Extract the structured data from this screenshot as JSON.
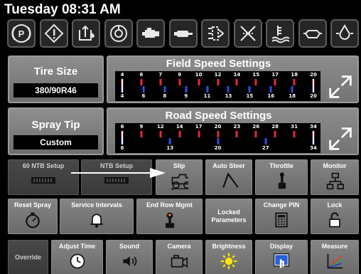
{
  "header": {
    "title": "Tuesday 08:31 AM"
  },
  "warning_icons": [
    {
      "icon": "parking-brake-icon"
    },
    {
      "icon": "warning-diamond-icon"
    },
    {
      "icon": "hydraulic-oil-icon"
    },
    {
      "icon": "engine-oil-pressure-icon"
    },
    {
      "icon": "engine-icon"
    },
    {
      "icon": "transmission-icon"
    },
    {
      "icon": "air-filter-icon"
    },
    {
      "icon": "fuel-filter-icon"
    },
    {
      "icon": "coolant-level-icon"
    },
    {
      "icon": "engine-check-icon"
    },
    {
      "icon": "oil-drop-icon"
    }
  ],
  "tire_size": {
    "label": "Tire Size",
    "value": "380/90R46"
  },
  "spray_tip": {
    "label": "Spray Tip",
    "value": "Custom"
  },
  "field_speed": {
    "title": "Field Speed Settings",
    "top_ticks": [
      "4",
      "6",
      "7",
      "9",
      "10",
      "12",
      "14",
      "15",
      "17",
      "18",
      "20"
    ],
    "bottom_ticks": [
      "4",
      "6",
      "8",
      "9",
      "11",
      "13",
      "15",
      "16",
      "18",
      "20"
    ]
  },
  "road_speed": {
    "title": "Road Speed Settings",
    "top_ticks": [
      "6",
      "9",
      "12",
      "14",
      "17",
      "20",
      "23",
      "26",
      "28",
      "31",
      "34"
    ],
    "bottom_ticks": [
      "6",
      "13",
      "20",
      "27",
      "34"
    ]
  },
  "grid": {
    "row1": [
      {
        "label": "60 NTB Setup",
        "icon": "ntb-wheel-icon",
        "dark": true
      },
      {
        "label": "NTB Setup",
        "icon": "ntb-wheel-icon",
        "dark": true
      },
      {
        "label": "Slip",
        "icon": "tractor-slip-icon",
        "dark": false
      },
      {
        "label": "Auto Steer",
        "icon": "steering-arrow-icon",
        "dark": false
      },
      {
        "label": "Throttle",
        "icon": "throttle-lever-icon",
        "dark": false
      },
      {
        "label": "Monitor",
        "icon": "network-icon",
        "dark": false
      }
    ],
    "row2": [
      {
        "label": "Reset Spray",
        "icon": "stopwatch-icon",
        "dark": false
      },
      {
        "label": "Service Intervals",
        "icon": "bell-icon",
        "dark": false
      },
      {
        "label": "End Row Mgmt",
        "icon": "joystick-icon",
        "dark": false
      },
      {
        "label": "Locked\nParameters",
        "icon": "",
        "dark": false
      },
      {
        "label": "Change PIN",
        "icon": "keypad-icon",
        "dark": false
      },
      {
        "label": "Lock",
        "icon": "padlock-icon",
        "dark": false
      }
    ],
    "row3": [
      {
        "label": "Override",
        "icon": "",
        "dark": true
      },
      {
        "label": "Adjust Time",
        "icon": "clock-icon",
        "dark": false
      },
      {
        "label": "Sound",
        "icon": "speaker-icon",
        "dark": false
      },
      {
        "label": "Camera",
        "icon": "camera-icon",
        "dark": false
      },
      {
        "label": "Brightness",
        "icon": "sun-icon",
        "dark": false
      },
      {
        "label": "Display",
        "icon": "touch-display-icon",
        "dark": false
      },
      {
        "label": "Measure",
        "icon": "graph-icon",
        "dark": false
      }
    ]
  },
  "colors": {
    "tick_red": "#e8283a",
    "tick_blue": "#2f4fd8",
    "arrow": "#ffffff",
    "display_icon_bg": "#2a5fd6",
    "brightness_yellow": "#ffe600"
  }
}
